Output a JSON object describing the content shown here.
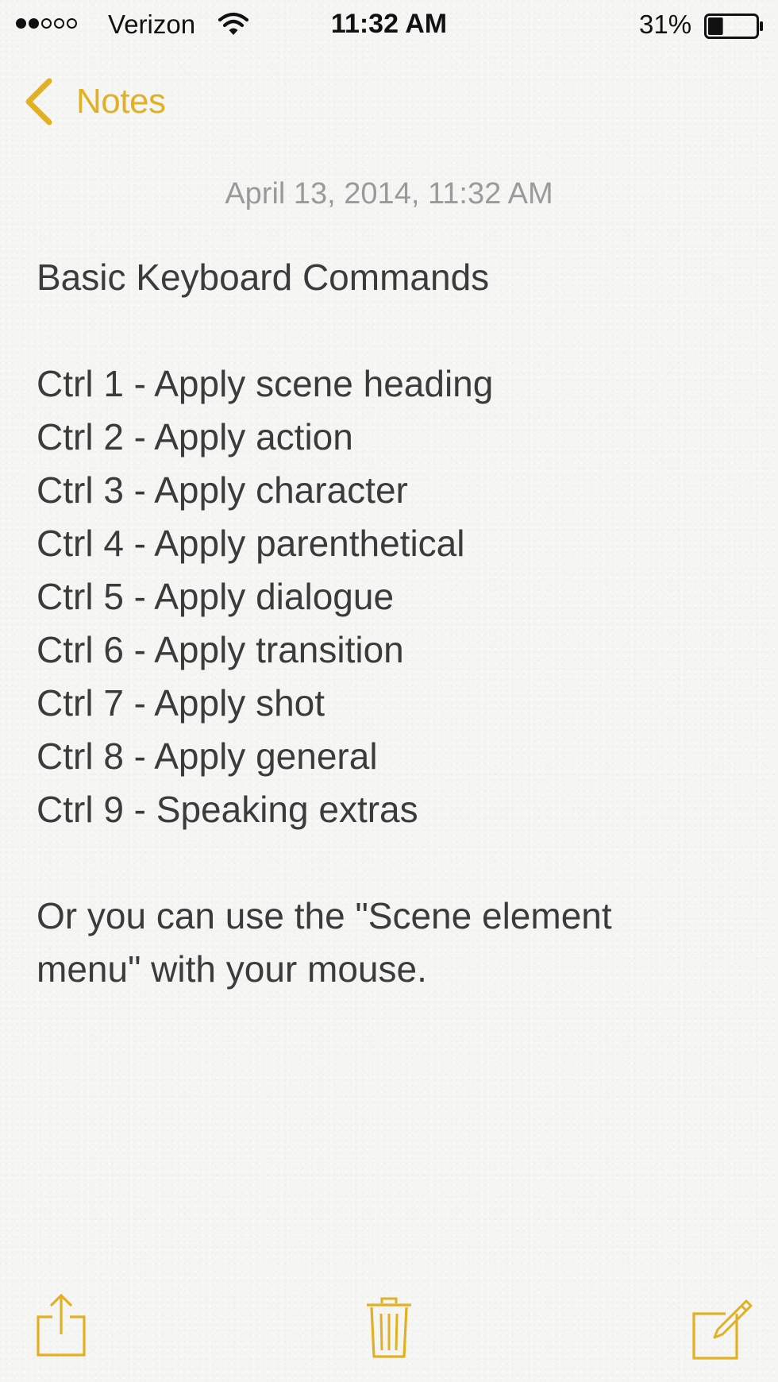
{
  "status_bar": {
    "signal_bars_filled": 2,
    "signal_bars_total": 5,
    "carrier": "Verizon",
    "time": "11:32 AM",
    "battery_percent": "31%",
    "battery_level": 0.31
  },
  "nav": {
    "back_label": "Notes"
  },
  "note": {
    "date": "April 13, 2014, 11:32 AM",
    "title": "Basic Keyboard Commands",
    "commands": [
      "Ctrl 1 - Apply scene heading",
      "Ctrl 2 - Apply action",
      "Ctrl 3 - Apply character",
      "Ctrl 4 - Apply parenthetical",
      "Ctrl 5 - Apply dialogue",
      "Ctrl 6 - Apply transition",
      "Ctrl 7 - Apply shot",
      "Ctrl 8 - Apply general",
      "Ctrl 9 - Speaking extras"
    ],
    "footer_lines": [
      "Or you can use the \"Scene element",
      "menu\" with your mouse."
    ]
  },
  "toolbar": {
    "share_icon": "share-icon",
    "trash_icon": "trash-icon",
    "compose_icon": "compose-icon"
  },
  "colors": {
    "accent": "#e2b123",
    "text": "#3b3b3b",
    "date": "#9a9a9a",
    "paper": "#f5f5f3"
  }
}
